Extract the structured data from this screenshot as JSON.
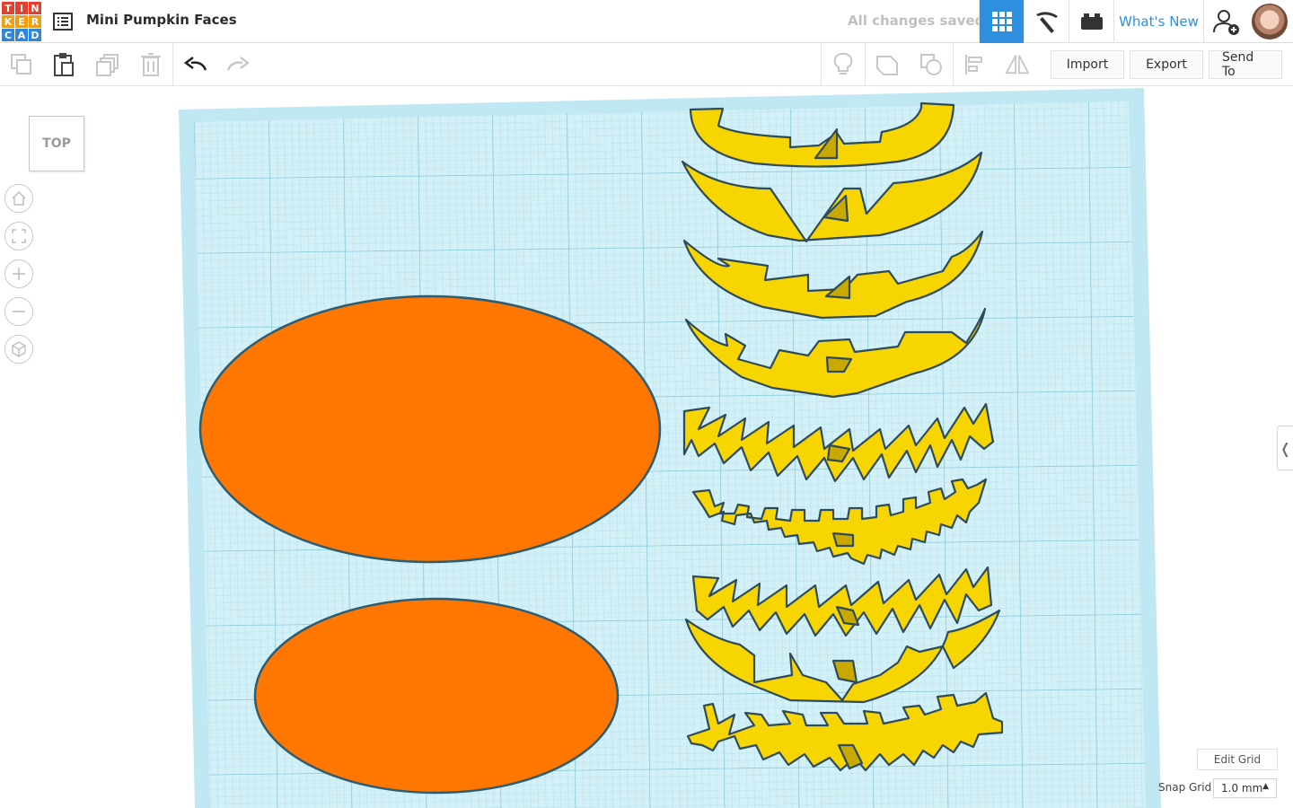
{
  "app": {
    "logo_letters": [
      "T",
      "I",
      "N",
      "K",
      "E",
      "R",
      "C",
      "A",
      "D"
    ],
    "logo_colors": [
      "#e2412f",
      "#e2412f",
      "#e2412f",
      "#2e86de",
      "#2e86de",
      "#2e86de",
      "#2e86de",
      "#2e86de",
      "#2e86de"
    ],
    "project_title": "Mini Pumpkin Faces",
    "save_status": "All changes saved",
    "whats_new": "What's New"
  },
  "toolbar": {
    "import_label": "Import",
    "export_label": "Export",
    "send_to_label": "Send To"
  },
  "viewport": {
    "view_cube_label": "TOP",
    "edit_grid_label": "Edit Grid",
    "snap_grid_label": "Snap Grid",
    "snap_grid_value": "1.0 mm"
  },
  "colors": {
    "accent": "#2f8fdf",
    "workplane": "#cfeff7",
    "pumpkin": "#ff7a00",
    "face": "#f7d500"
  },
  "icons": [
    "home-icon",
    "fit-icon",
    "zoom-in-icon",
    "zoom-out-icon",
    "perspective-icon",
    "copy-icon",
    "paste-icon",
    "duplicate-icon",
    "delete-icon",
    "undo-icon",
    "redo-icon",
    "note-icon",
    "group-icon",
    "ungroup-icon",
    "align-icon",
    "mirror-icon"
  ]
}
